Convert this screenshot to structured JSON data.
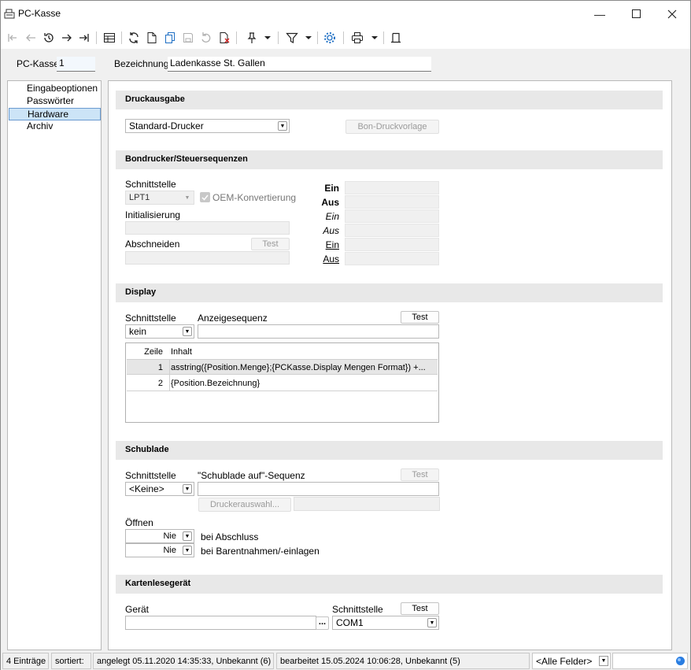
{
  "window": {
    "title": "PC-Kasse"
  },
  "header": {
    "pckasse_label": "PC-Kasse",
    "pckasse_value": "1",
    "bezeichnung_label": "Bezeichnung",
    "bezeichnung_value": "Ladenkasse St. Gallen"
  },
  "nav": {
    "items": [
      "Eingabeoptionen",
      "Passwörter",
      "Hardware",
      "Archiv"
    ],
    "selected": "Hardware"
  },
  "druckausgabe": {
    "title": "Druckausgabe",
    "printer": "Standard-Drucker",
    "template_button": "Bon-Druckvorlage"
  },
  "bondrucker": {
    "title": "Bondrucker/Steuersequenzen",
    "schnittstelle_label": "Schnittstelle",
    "schnittstelle_value": "LPT1",
    "oem_label": "OEM-Konvertierung",
    "oem_checked": true,
    "init_label": "Initialisierung",
    "abschneiden_label": "Abschneiden",
    "test_button": "Test",
    "seq_labels": [
      "Ein",
      "Aus",
      "Ein",
      "Aus",
      "Ein",
      "Aus"
    ]
  },
  "display": {
    "title": "Display",
    "schnittstelle_label": "Schnittstelle",
    "schnittstelle_value": "kein",
    "sequenz_label": "Anzeigesequenz",
    "test_button": "Test",
    "grid_headers": [
      "Zeile",
      "Inhalt"
    ],
    "rows": [
      {
        "zeile": "1",
        "inhalt": "asstring({Position.Menge};{PCKasse.Display Mengen Format}) +..."
      },
      {
        "zeile": "2",
        "inhalt": "{Position.Bezeichnung}"
      }
    ]
  },
  "schublade": {
    "title": "Schublade",
    "schnittstelle_label": "Schnittstelle",
    "schnittstelle_value": "<Keine>",
    "sequenz_label": "\"Schublade auf\"-Sequenz",
    "test_button": "Test",
    "drucker_button": "Druckerauswahl...",
    "oeffnen_label": "Öffnen",
    "opt1_value": "Nie",
    "opt1_label": "bei Abschluss",
    "opt2_value": "Nie",
    "opt2_label": "bei Barentnahmen/-einlagen"
  },
  "karten": {
    "title": "Kartenlesegerät",
    "geraet_label": "Gerät",
    "browse_button": "...",
    "schnittstelle_label": "Schnittstelle",
    "test_button": "Test",
    "schnittstelle_value": "COM1"
  },
  "status": {
    "count": "4 Einträge",
    "sorted": "sortiert:",
    "created": "angelegt 05.11.2020 14:35:33, Unbekannt (6)",
    "edited": "bearbeitet 15.05.2024 10:06:28, Unbekannt (5)",
    "filter": "<Alle Felder>"
  }
}
